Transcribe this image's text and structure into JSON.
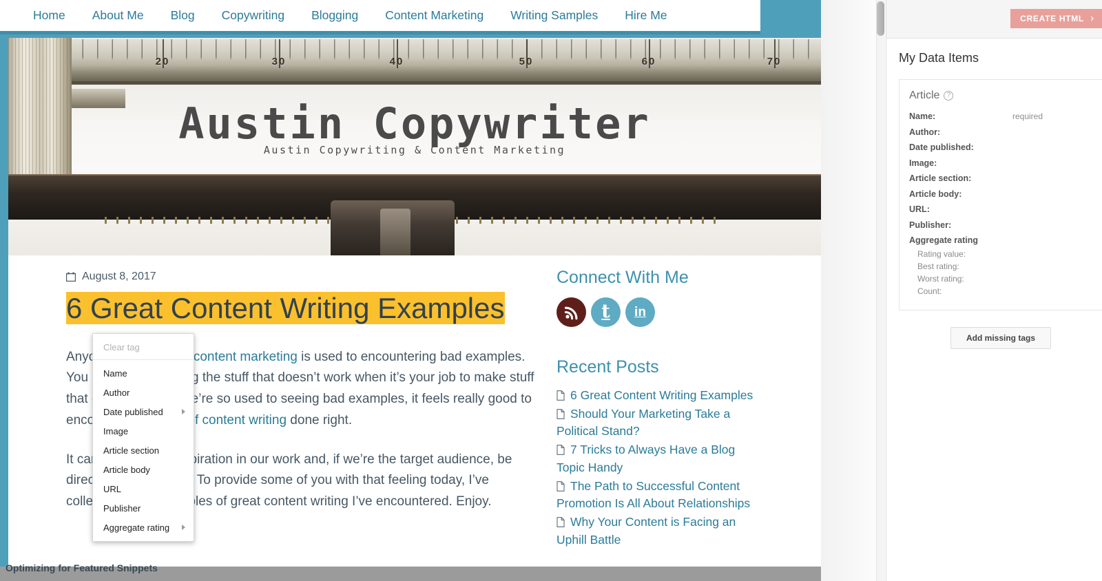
{
  "site": {
    "nav": [
      {
        "label": "Home"
      },
      {
        "label": "About Me"
      },
      {
        "label": "Blog"
      },
      {
        "label": "Copywriting"
      },
      {
        "label": "Blogging"
      },
      {
        "label": "Content Marketing"
      },
      {
        "label": "Writing Samples"
      },
      {
        "label": "Hire Me"
      }
    ],
    "banner": {
      "title": "Austin Copywriter",
      "subtitle": "Austin Copywriting & Content Marketing",
      "ruler_marks": [
        "20",
        "30",
        "40",
        "50",
        "60",
        "70"
      ]
    }
  },
  "article": {
    "date": "August 8, 2017",
    "title": "6 Great Content Writing Examples",
    "paragraph1_a": "Anyone who works in ",
    "paragraph1_link": "content marketing",
    "paragraph1_b": " is used to encountering bad examples. You get used to seeing the stuff that doesn’t work when it’s your job to make stuff that does. Because we’re so used to seeing bad examples, it feels really good to encounter ",
    "paragraph1_link2": "examples of content writing",
    "paragraph1_c": " done right.",
    "paragraph2": "It can spark some inspiration in our work and, if we’re the target audience, be directly useful as well. To provide some of you with that feeling today, I’ve collected a few examples of great content writing I’ve encountered. Enjoy."
  },
  "sidebar": {
    "connect_heading": "Connect With Me",
    "social": [
      {
        "name": "rss",
        "label": "RSS"
      },
      {
        "name": "twitter",
        "label": "t"
      },
      {
        "name": "linkedin",
        "label": "in"
      }
    ],
    "recent_heading": "Recent Posts",
    "recent_posts": [
      "6 Great Content Writing Examples",
      "Should Your Marketing Take a Political Stand?",
      "7 Tricks to Always Have a Blog Topic Handy",
      "The Path to Successful Content Promotion Is All About Relationships",
      "Why Your Content is Facing an Uphill Battle"
    ]
  },
  "footer": {
    "partial_text": "Optimizing for Featured Snippets"
  },
  "context_menu": {
    "clear_label": "Clear tag",
    "items": [
      {
        "label": "Name",
        "has_submenu": false
      },
      {
        "label": "Author",
        "has_submenu": false
      },
      {
        "label": "Date published",
        "has_submenu": true
      },
      {
        "label": "Image",
        "has_submenu": false
      },
      {
        "label": "Article section",
        "has_submenu": false
      },
      {
        "label": "Article body",
        "has_submenu": false
      },
      {
        "label": "URL",
        "has_submenu": false
      },
      {
        "label": "Publisher",
        "has_submenu": false
      },
      {
        "label": "Aggregate rating",
        "has_submenu": true
      }
    ]
  },
  "tool": {
    "create_html_label": "CREATE HTML",
    "create_html_chevron": "›",
    "panel_title": "My Data Items",
    "card": {
      "type_label": "Article",
      "help_glyph": "?",
      "properties": [
        {
          "key": "Name:",
          "value": "required"
        },
        {
          "key": "Author:",
          "value": ""
        },
        {
          "key": "Date published:",
          "value": ""
        },
        {
          "key": "Image:",
          "value": ""
        },
        {
          "key": "Article section:",
          "value": ""
        },
        {
          "key": "Article body:",
          "value": ""
        },
        {
          "key": "URL:",
          "value": ""
        },
        {
          "key": "Publisher:",
          "value": ""
        }
      ],
      "group_label": "Aggregate rating",
      "group_items": [
        "Rating value:",
        "Best rating:",
        "Worst rating:",
        "Count:"
      ]
    },
    "add_tags_label": "Add missing tags"
  },
  "colors": {
    "teal": "#4e9fba",
    "nav_link": "#2b7b99",
    "highlight": "#fbc02d",
    "create_html": "#e9a09a",
    "rss": "#5e1f1a"
  }
}
